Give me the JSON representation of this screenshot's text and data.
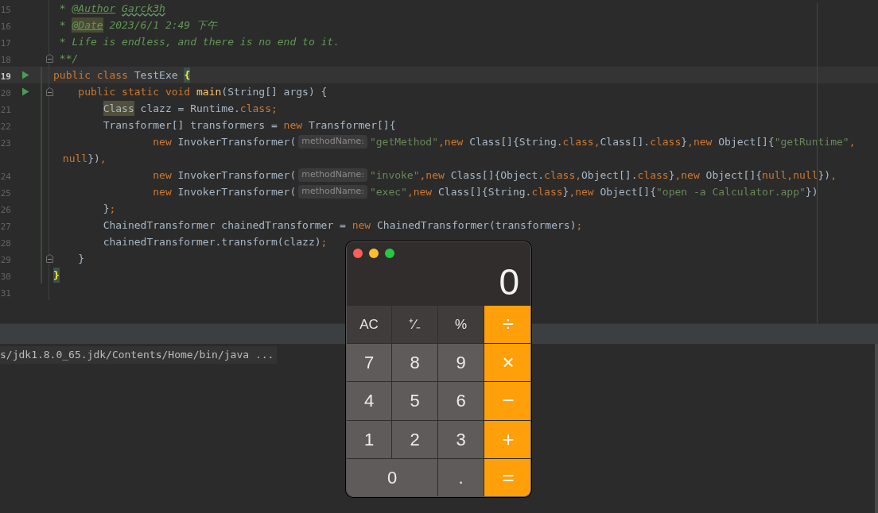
{
  "editor": {
    "lines": [
      {
        "number": "15",
        "run": false,
        "fold": false,
        "modified": false,
        "current": false,
        "tokens": [
          {
            "text": " * ",
            "kind": "doc"
          },
          {
            "text": "@Author",
            "kind": "doc-tag"
          },
          {
            "text": " Garck3h",
            "kind": "doc-typo"
          }
        ]
      },
      {
        "number": "16",
        "run": false,
        "fold": false,
        "modified": false,
        "current": false,
        "tokens": [
          {
            "text": " * ",
            "kind": "doc"
          },
          {
            "text": "@Date",
            "kind": "doc-tag-marked"
          },
          {
            "text": " 2023/6/1 2:49 下午",
            "kind": "doc"
          }
        ]
      },
      {
        "number": "17",
        "run": false,
        "fold": false,
        "modified": false,
        "current": false,
        "tokens": [
          {
            "text": " * Life is endless, and there is no end to it.",
            "kind": "doc"
          }
        ]
      },
      {
        "number": "18",
        "run": false,
        "fold": true,
        "modified": false,
        "current": false,
        "tokens": [
          {
            "text": " **/",
            "kind": "doc"
          }
        ]
      },
      {
        "number": "19",
        "run": true,
        "fold": false,
        "modified": true,
        "current": true,
        "tokens": [
          {
            "text": "public class ",
            "kind": "keyword"
          },
          {
            "text": "TestExe ",
            "kind": "plain"
          },
          {
            "text": "{",
            "kind": "brace-match"
          }
        ]
      },
      {
        "number": "20",
        "run": true,
        "fold": true,
        "modified": true,
        "current": false,
        "tokens": [
          {
            "text": "    public static void ",
            "kind": "keyword"
          },
          {
            "text": "main",
            "kind": "method"
          },
          {
            "text": "(String[] args) {",
            "kind": "plain"
          }
        ]
      },
      {
        "number": "21",
        "run": false,
        "fold": false,
        "modified": true,
        "current": false,
        "tokens": [
          {
            "text": "        Class",
            "kind": "type-marked"
          },
          {
            "text": " clazz = Runtime.",
            "kind": "plain"
          },
          {
            "text": "class;",
            "kind": "keyword"
          }
        ]
      },
      {
        "number": "22",
        "run": false,
        "fold": false,
        "modified": true,
        "current": false,
        "tokens": [
          {
            "text": "        Transformer[] transformers = ",
            "kind": "plain"
          },
          {
            "text": "new ",
            "kind": "keyword"
          },
          {
            "text": "Transformer[]{",
            "kind": "plain"
          }
        ]
      },
      {
        "number": "23",
        "run": false,
        "fold": false,
        "modified": true,
        "current": false,
        "tokens": [
          {
            "text": "                new ",
            "kind": "keyword"
          },
          {
            "text": "InvokerTransformer(",
            "kind": "plain"
          },
          {
            "text": "methodName:",
            "kind": "hint"
          },
          {
            "text": "\"getMethod\"",
            "kind": "string"
          },
          {
            "text": ",new ",
            "kind": "keyword"
          },
          {
            "text": "Class[]{String.",
            "kind": "plain"
          },
          {
            "text": "class,",
            "kind": "keyword"
          },
          {
            "text": "Class[].",
            "kind": "plain"
          },
          {
            "text": "class",
            "kind": "keyword"
          },
          {
            "text": "}",
            "kind": "plain"
          },
          {
            "text": ",new ",
            "kind": "keyword"
          },
          {
            "text": "Object[]{",
            "kind": "plain"
          },
          {
            "text": "\"getRuntime\"",
            "kind": "string"
          },
          {
            "text": ",",
            "kind": "keyword"
          }
        ]
      },
      {
        "run": false,
        "fold": false,
        "modified": true,
        "current": false,
        "tokens": [
          {
            "text": " null",
            "kind": "keyword"
          },
          {
            "text": "})",
            "kind": "plain"
          },
          {
            "text": ",",
            "kind": "keyword"
          }
        ]
      },
      {
        "number": "24",
        "run": false,
        "fold": false,
        "modified": true,
        "current": false,
        "tokens": [
          {
            "text": "                new ",
            "kind": "keyword"
          },
          {
            "text": "InvokerTransformer(",
            "kind": "plain"
          },
          {
            "text": "methodName:",
            "kind": "hint"
          },
          {
            "text": "\"invoke\"",
            "kind": "string"
          },
          {
            "text": ",new ",
            "kind": "keyword"
          },
          {
            "text": "Class[]{Object.",
            "kind": "plain"
          },
          {
            "text": "class,",
            "kind": "keyword"
          },
          {
            "text": "Object[].",
            "kind": "plain"
          },
          {
            "text": "class",
            "kind": "keyword"
          },
          {
            "text": "}",
            "kind": "plain"
          },
          {
            "text": ",new ",
            "kind": "keyword"
          },
          {
            "text": "Object[]{",
            "kind": "plain"
          },
          {
            "text": "null,null",
            "kind": "keyword"
          },
          {
            "text": "})",
            "kind": "plain"
          },
          {
            "text": ",",
            "kind": "keyword"
          }
        ]
      },
      {
        "number": "25",
        "run": false,
        "fold": false,
        "modified": true,
        "current": false,
        "tokens": [
          {
            "text": "                new ",
            "kind": "keyword"
          },
          {
            "text": "InvokerTransformer(",
            "kind": "plain"
          },
          {
            "text": "methodName:",
            "kind": "hint"
          },
          {
            "text": "\"exec\"",
            "kind": "string"
          },
          {
            "text": ",new ",
            "kind": "keyword"
          },
          {
            "text": "Class[]{String.",
            "kind": "plain"
          },
          {
            "text": "class",
            "kind": "keyword"
          },
          {
            "text": "}",
            "kind": "plain"
          },
          {
            "text": ",new ",
            "kind": "keyword"
          },
          {
            "text": "Object[]{",
            "kind": "plain"
          },
          {
            "text": "\"open -a Calculator.app\"",
            "kind": "string"
          },
          {
            "text": "})",
            "kind": "plain"
          }
        ]
      },
      {
        "number": "26",
        "run": false,
        "fold": false,
        "modified": true,
        "current": false,
        "tokens": [
          {
            "text": "        }",
            "kind": "plain"
          },
          {
            "text": ";",
            "kind": "keyword"
          }
        ]
      },
      {
        "number": "27",
        "run": false,
        "fold": false,
        "modified": true,
        "current": false,
        "tokens": [
          {
            "text": "        ChainedTransformer chainedTransformer = ",
            "kind": "plain"
          },
          {
            "text": "new ",
            "kind": "keyword"
          },
          {
            "text": "ChainedTransformer(transformers)",
            "kind": "plain"
          },
          {
            "text": ";",
            "kind": "keyword"
          }
        ]
      },
      {
        "number": "28",
        "run": false,
        "fold": false,
        "modified": true,
        "current": false,
        "tokens": [
          {
            "text": "        chainedTransformer.transform(clazz)",
            "kind": "plain"
          },
          {
            "text": ";",
            "kind": "keyword"
          }
        ]
      },
      {
        "number": "29",
        "run": false,
        "fold": true,
        "modified": true,
        "current": false,
        "tokens": [
          {
            "text": "    }",
            "kind": "plain"
          }
        ]
      },
      {
        "number": "30",
        "run": false,
        "fold": false,
        "modified": true,
        "current": false,
        "tokens": [
          {
            "text": "}",
            "kind": "brace-match"
          }
        ]
      },
      {
        "number": "31",
        "run": false,
        "fold": false,
        "modified": false,
        "current": false
      }
    ]
  },
  "console": {
    "lines": [
      "s/jdk1.8.0_65.jdk/Contents/Home/bin/java ..."
    ]
  },
  "calculator": {
    "window_controls": [
      {
        "color": "#ff5f57"
      },
      {
        "color": "#febc2e"
      },
      {
        "color": "#28c840"
      }
    ],
    "display": "0",
    "keys": [
      {
        "label": "AC",
        "kind": "function",
        "wide": false
      },
      {
        "label": "⁺∕₋",
        "kind": "function",
        "wide": false
      },
      {
        "label": "%",
        "kind": "function",
        "wide": false
      },
      {
        "label": "÷",
        "kind": "operator",
        "wide": false
      },
      {
        "label": "7",
        "kind": "digit",
        "wide": false
      },
      {
        "label": "8",
        "kind": "digit",
        "wide": false
      },
      {
        "label": "9",
        "kind": "digit",
        "wide": false
      },
      {
        "label": "×",
        "kind": "operator",
        "wide": false
      },
      {
        "label": "4",
        "kind": "digit",
        "wide": false
      },
      {
        "label": "5",
        "kind": "digit",
        "wide": false
      },
      {
        "label": "6",
        "kind": "digit",
        "wide": false
      },
      {
        "label": "−",
        "kind": "operator",
        "wide": false
      },
      {
        "label": "1",
        "kind": "digit",
        "wide": false
      },
      {
        "label": "2",
        "kind": "digit",
        "wide": false
      },
      {
        "label": "3",
        "kind": "digit",
        "wide": false
      },
      {
        "label": "+",
        "kind": "operator",
        "wide": false
      },
      {
        "label": "0",
        "kind": "digit",
        "wide": true
      },
      {
        "label": ".",
        "kind": "digit",
        "wide": false
      },
      {
        "label": "=",
        "kind": "operator",
        "wide": false
      }
    ]
  }
}
